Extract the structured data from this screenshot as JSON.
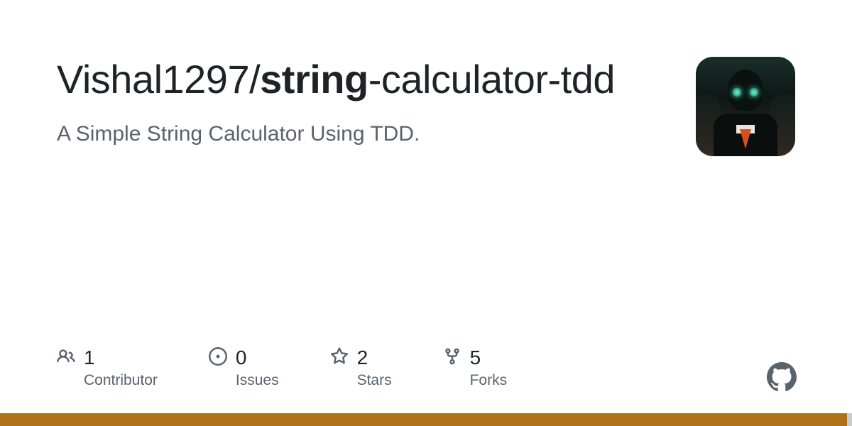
{
  "repo": {
    "owner": "Vishal1297",
    "separator": "/",
    "name_bold": "string",
    "name_rest": "-calculator-tdd"
  },
  "description": "A Simple String Calculator Using TDD.",
  "stats": {
    "contributors": {
      "count": "1",
      "label": "Contributor"
    },
    "issues": {
      "count": "0",
      "label": "Issues"
    },
    "stars": {
      "count": "2",
      "label": "Stars"
    },
    "forks": {
      "count": "5",
      "label": "Forks"
    }
  },
  "colors": {
    "bar_primary": "#b07219",
    "bar_secondary": "#cccccc",
    "bar_primary_width": "99.4%",
    "bar_secondary_width": "0.6%"
  }
}
